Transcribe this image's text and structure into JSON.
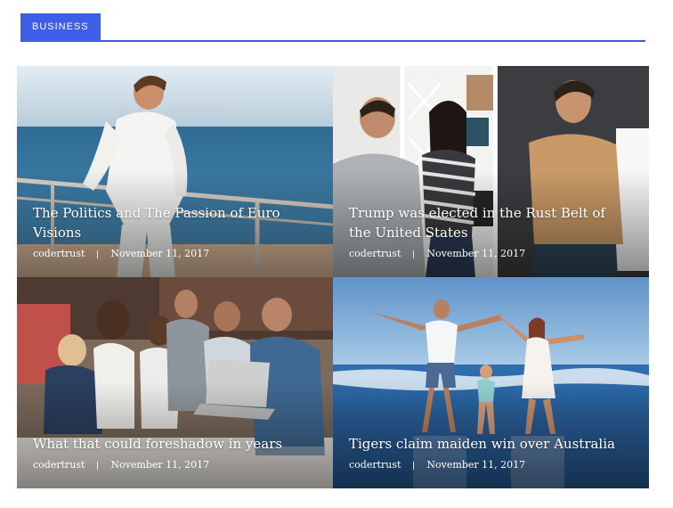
{
  "section": {
    "label": "Business",
    "accent_color": "#3f5ee8"
  },
  "posts": [
    {
      "title": "The Politics and The Passion of Euro Visions",
      "author": "codertrust",
      "date": "November 11, 2017",
      "image": "man-on-ship-deck-sea-photo"
    },
    {
      "title": "Trump was elected in the Rust Belt of the United States",
      "author": "codertrust",
      "date": "November 11, 2017",
      "image": "office-team-meeting-photo"
    },
    {
      "title": "What that could foreshadow in years",
      "author": "codertrust",
      "date": "November 11, 2017",
      "image": "group-around-laptop-photo"
    },
    {
      "title": "Tigers claim maiden win over Australia",
      "author": "codertrust",
      "date": "November 11, 2017",
      "image": "family-on-beach-photo"
    }
  ]
}
